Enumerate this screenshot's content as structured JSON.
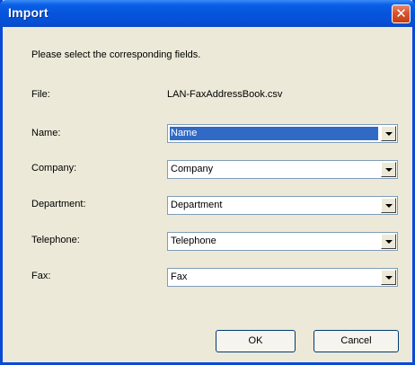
{
  "window": {
    "title": "Import",
    "close_glyph": "✕",
    "colors": {
      "titlebar": "#0654dc",
      "client_background": "#ece9d8",
      "selection": "#316ac5",
      "close_button": "#d8542e"
    }
  },
  "instructions": "Please select the corresponding fields.",
  "file": {
    "label": "File:",
    "value": "LAN-FaxAddressBook.csv"
  },
  "fields": [
    {
      "label": "Name:",
      "value": "Name",
      "selected": true
    },
    {
      "label": "Company:",
      "value": "Company",
      "selected": false
    },
    {
      "label": "Department:",
      "value": "Department",
      "selected": false
    },
    {
      "label": "Telephone:",
      "value": "Telephone",
      "selected": false
    },
    {
      "label": "Fax:",
      "value": "Fax",
      "selected": false
    }
  ],
  "buttons": {
    "ok": "OK",
    "cancel": "Cancel"
  },
  "icons": {
    "close": "close-icon",
    "dropdown": "chevron-down-icon"
  }
}
